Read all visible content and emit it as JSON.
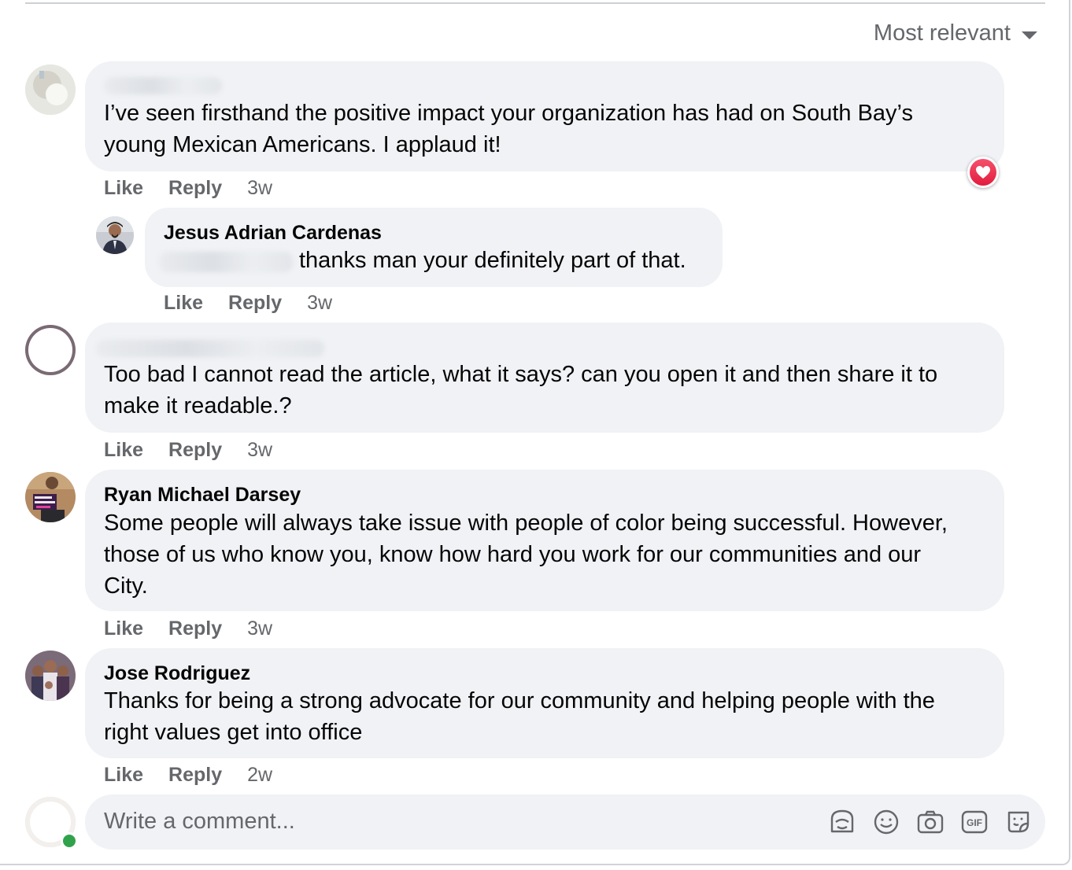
{
  "sort": {
    "label": "Most relevant"
  },
  "comments": [
    {
      "author": "",
      "text_lines": [
        "I’ve seen firsthand the positive impact your organization has had on South Bay’s",
        "young Mexican Americans. I applaud it!"
      ],
      "like": "Like",
      "reply": "Reply",
      "time": "3w",
      "reaction": "love"
    },
    {
      "author": "Jesus Adrian Cardenas",
      "text_lines": [
        "thanks man your definitely part of that."
      ],
      "like": "Like",
      "reply": "Reply",
      "time": "3w"
    },
    {
      "author": "",
      "text_lines": [
        "Too bad I cannot read the article, what it says? can you open it and then share it to",
        "make it readable.?"
      ],
      "like": "Like",
      "reply": "Reply",
      "time": "3w"
    },
    {
      "author": "Ryan Michael Darsey",
      "text_lines": [
        "Some people will always take issue with people of color being successful. However,",
        "those of us who know you, know how hard you work for our communities and our",
        "City."
      ],
      "like": "Like",
      "reply": "Reply",
      "time": "3w"
    },
    {
      "author": "Jose Rodriguez",
      "text_lines": [
        "Thanks for being a strong advocate for our community and helping people with the",
        "right values get into office"
      ],
      "like": "Like",
      "reply": "Reply",
      "time": "2w"
    }
  ],
  "composer": {
    "placeholder": "Write a comment...",
    "icons": [
      "avatar-sticker-icon",
      "emoji-icon",
      "camera-icon",
      "gif-icon",
      "sticker-icon"
    ]
  },
  "colors": {
    "bubble": "#f0f2f5",
    "secondary_text": "#65676b",
    "love": "#f33e58",
    "online": "#31a24c"
  }
}
